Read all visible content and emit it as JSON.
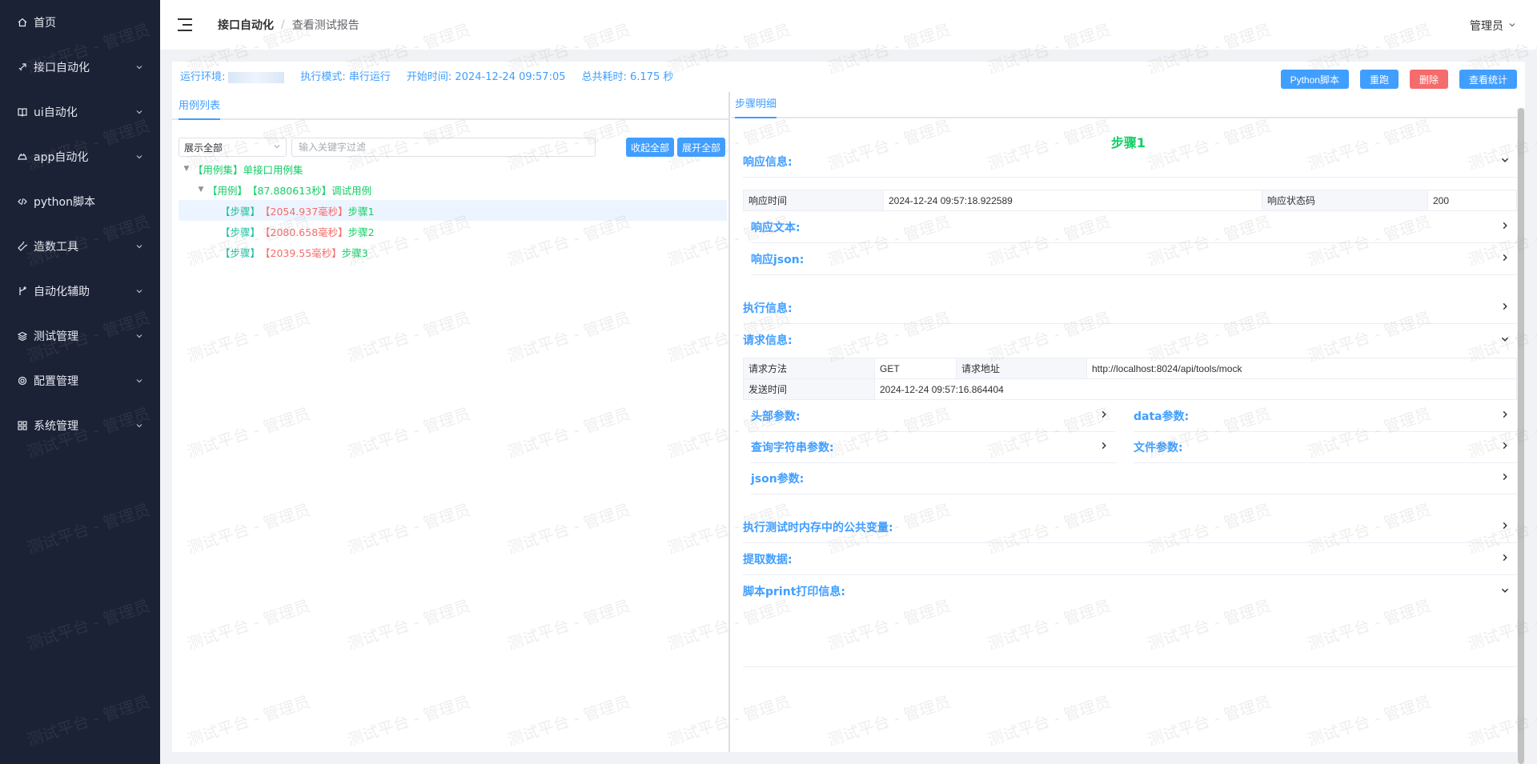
{
  "sidebar": {
    "items": [
      {
        "label": "首页",
        "icon": "home-icon",
        "has_arrow": false
      },
      {
        "label": "接口自动化",
        "icon": "rocket-icon",
        "has_arrow": true
      },
      {
        "label": "ui自动化",
        "icon": "book-icon",
        "has_arrow": true
      },
      {
        "label": "app自动化",
        "icon": "mobile-icon",
        "has_arrow": true
      },
      {
        "label": "python脚本",
        "icon": "code-icon",
        "has_arrow": false
      },
      {
        "label": "造数工具",
        "icon": "wrench-icon",
        "has_arrow": true
      },
      {
        "label": "自动化辅助",
        "icon": "branch-icon",
        "has_arrow": true
      },
      {
        "label": "测试管理",
        "icon": "layers-icon",
        "has_arrow": true
      },
      {
        "label": "配置管理",
        "icon": "gear-icon",
        "has_arrow": true
      },
      {
        "label": "系统管理",
        "icon": "grid-icon",
        "has_arrow": true
      }
    ]
  },
  "header": {
    "breadcrumb_parent": "接口自动化",
    "breadcrumb_sep": "/",
    "breadcrumb_current": "查看测试报告",
    "user": "管理员"
  },
  "run_info": {
    "env_label": "运行环境:",
    "mode": "执行模式: 串行运行",
    "start_time": "开始时间: 2024-12-24 09:57:05",
    "total_time": "总共耗时: 6.175 秒"
  },
  "actions": {
    "python_script": "Python脚本",
    "rerun": "重跑",
    "delete": "删除",
    "stats": "查看统计"
  },
  "left_panel": {
    "tab": "用例列表",
    "filter_select": "展示全部",
    "filter_placeholder": "输入关键字过滤",
    "collapse_all": "收起全部",
    "expand_all": "展开全部",
    "tree": {
      "suite": "【用例集】单接口用例集",
      "case_tag": "【用例】",
      "case_time": "【87.880613秒】",
      "case_name": "调试用例",
      "steps": [
        {
          "tag": "【步骤】",
          "time": "【2054.937毫秒】",
          "name": "步骤1"
        },
        {
          "tag": "【步骤】",
          "time": "【2080.658毫秒】",
          "name": "步骤2"
        },
        {
          "tag": "【步骤】",
          "time": "【2039.55毫秒】",
          "name": "步骤3"
        }
      ]
    }
  },
  "right_panel": {
    "tab": "步骤明细",
    "step_title": "步骤1",
    "response_info": "响应信息:",
    "response_table": {
      "k1": "响应时间",
      "v1": "2024-12-24 09:57:18.922589",
      "k2": "响应状态码",
      "v2": "200"
    },
    "response_text": "响应文本:",
    "response_json": "响应json:",
    "exec_info": "执行信息:",
    "request_info": "请求信息:",
    "request_table": {
      "k1": "请求方法",
      "v1": "GET",
      "k2": "请求地址",
      "v2": "http://localhost:8024/api/tools/mock",
      "k3": "发送时间",
      "v3": "2024-12-24 09:57:16.864404"
    },
    "headers": "头部参数:",
    "data_params": "data参数:",
    "query_params": "查询字符串参数:",
    "file_params": "文件参数:",
    "json_params": "json参数:",
    "public_vars": "执行测试时内存中的公共变量:",
    "extract": "提取数据:",
    "script_print": "脚本print打印信息:"
  },
  "watermark": "测试平台 - 管理员",
  "colors": {
    "primary": "#409eff",
    "danger": "#f56c6c",
    "success": "#13ce66",
    "sidebar_bg": "#1c2236"
  }
}
